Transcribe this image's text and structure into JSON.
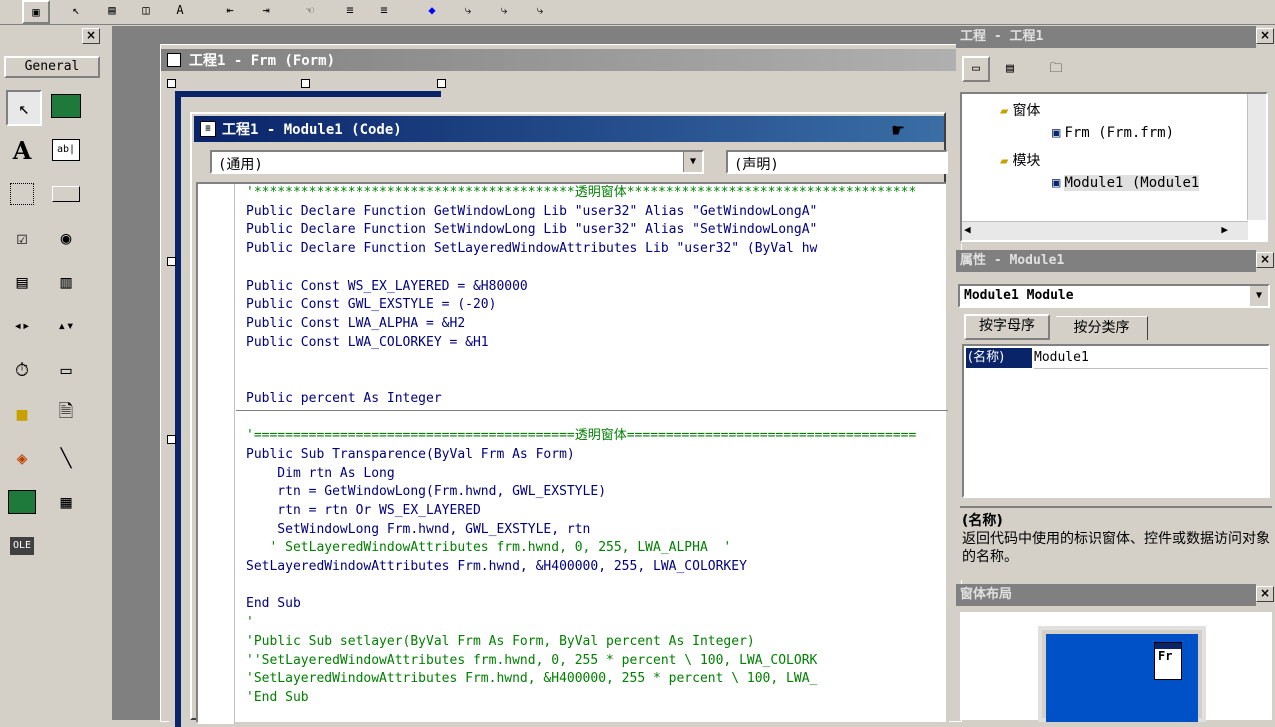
{
  "toolbox": {
    "tab_label": "General",
    "close": "×"
  },
  "form_window": {
    "title": "工程1 - Frm (Form)"
  },
  "code_window": {
    "title": "工程1 - Module1 (Code)",
    "object_combo": "(通用)",
    "proc_combo": "(声明)",
    "lines": [
      {
        "cls": "cm",
        "text": "'*****************************************透明窗体*************************************"
      },
      {
        "cls": "kw",
        "text": "Public Declare Function GetWindowLong Lib \"user32\" Alias \"GetWindowLongA\""
      },
      {
        "cls": "kw",
        "text": "Public Declare Function SetWindowLong Lib \"user32\" Alias \"SetWindowLongA\""
      },
      {
        "cls": "kw",
        "text": "Public Declare Function SetLayeredWindowAttributes Lib \"user32\" (ByVal hw"
      },
      {
        "cls": "tx",
        "text": ""
      },
      {
        "cls": "kw",
        "text": "Public Const WS_EX_LAYERED = &H80000"
      },
      {
        "cls": "kw",
        "text": "Public Const GWL_EXSTYLE = (-20)"
      },
      {
        "cls": "kw",
        "text": "Public Const LWA_ALPHA = &H2"
      },
      {
        "cls": "kw",
        "text": "Public Const LWA_COLORKEY = &H1"
      },
      {
        "cls": "tx",
        "text": ""
      },
      {
        "cls": "tx",
        "text": ""
      },
      {
        "cls": "kw",
        "text": "Public percent As Integer"
      },
      {
        "cls": "tx",
        "text": ""
      },
      {
        "cls": "cm",
        "text": "'=========================================透明窗体====================================="
      },
      {
        "cls": "kw",
        "text": "Public Sub Transparence(ByVal Frm As Form)"
      },
      {
        "cls": "kw",
        "text": "    Dim rtn As Long"
      },
      {
        "cls": "kw",
        "text": "    rtn = GetWindowLong(Frm.hwnd, GWL_EXSTYLE)"
      },
      {
        "cls": "kw",
        "text": "    rtn = rtn Or WS_EX_LAYERED"
      },
      {
        "cls": "kw",
        "text": "    SetWindowLong Frm.hwnd, GWL_EXSTYLE, rtn"
      },
      {
        "cls": "cm",
        "text": "   ' SetLayeredWindowAttributes frm.hwnd, 0, 255, LWA_ALPHA  '"
      },
      {
        "cls": "kw",
        "text": "SetLayeredWindowAttributes Frm.hwnd, &H400000, 255, LWA_COLORKEY"
      },
      {
        "cls": "tx",
        "text": ""
      },
      {
        "cls": "kw",
        "text": "End Sub"
      },
      {
        "cls": "cm",
        "text": "'"
      },
      {
        "cls": "cm",
        "text": "'Public Sub setlayer(ByVal Frm As Form, ByVal percent As Integer)"
      },
      {
        "cls": "cm",
        "text": "''SetLayeredWindowAttributes frm.hwnd, 0, 255 * percent \\ 100, LWA_COLORK"
      },
      {
        "cls": "cm",
        "text": "'SetLayeredWindowAttributes Frm.hwnd, &H400000, 255 * percent \\ 100, LWA_"
      },
      {
        "cls": "cm",
        "text": "'End Sub"
      }
    ]
  },
  "project_panel": {
    "title": "工程 - 工程1",
    "tree": [
      {
        "text": "窗体",
        "level": 1
      },
      {
        "text": "Frm (Frm.frm)",
        "level": 2
      },
      {
        "text": "模块",
        "level": 1
      },
      {
        "text": "Module1 (Module1",
        "level": 2
      }
    ],
    "close": "×"
  },
  "properties_panel": {
    "title": "属性 - Module1",
    "object_combo": "Module1 Module",
    "tab_alpha": "按字母序",
    "tab_category": "按分类序",
    "prop_name": "(名称)",
    "prop_value": "Module1",
    "desc_title": "(名称)",
    "desc_text": "返回代码中使用的标识窗体、控件或数据访问对象的名称。",
    "close": "×"
  },
  "layout_panel": {
    "title": "窗体布局",
    "preview_label": "Fr",
    "close": "×"
  },
  "colors": {
    "title_active": "#0a246a",
    "keyword": "#00007f",
    "comment": "#008000",
    "preview_blue": "#0050c8"
  }
}
